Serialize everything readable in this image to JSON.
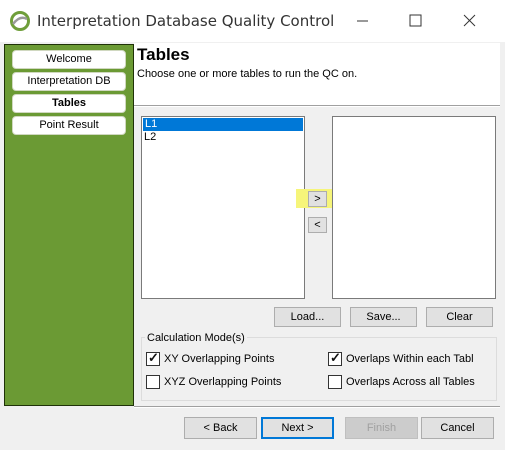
{
  "window": {
    "title": "Interpretation Database Quality Control",
    "icon": "app-logo-icon",
    "controls": {
      "minimize": "minimize-icon",
      "maximize": "maximize-icon",
      "close": "close-icon"
    }
  },
  "sidebar": {
    "items": [
      {
        "label": "Welcome",
        "active": false
      },
      {
        "label": "Interpretation DB",
        "active": false
      },
      {
        "label": "Tables",
        "active": true
      },
      {
        "label": "Point Result",
        "active": false
      }
    ]
  },
  "header": {
    "title": "Tables",
    "subtitle": "Choose one or more tables to run the QC on."
  },
  "tables": {
    "available": [
      {
        "label": "L1",
        "selected": true
      },
      {
        "label": "L2",
        "selected": false
      }
    ],
    "chosen": [],
    "move_right": ">",
    "move_left": "<",
    "load": "Load...",
    "save": "Save...",
    "clear": "Clear"
  },
  "calc_mode": {
    "label": "Calculation Mode(s)",
    "options": [
      {
        "label": "XY Overlapping Points",
        "checked": true
      },
      {
        "label": "Overlaps Within each Table",
        "checked": true
      },
      {
        "label": "XYZ Overlapping Points",
        "checked": false
      },
      {
        "label": "Overlaps Across all Tables",
        "checked": false
      }
    ]
  },
  "footer": {
    "back": "< Back",
    "next": "Next >",
    "finish": "Finish",
    "cancel": "Cancel"
  },
  "colors": {
    "sidebar": "#6b9a34",
    "selection": "#0078d7",
    "highlight": "#f6f57a"
  }
}
